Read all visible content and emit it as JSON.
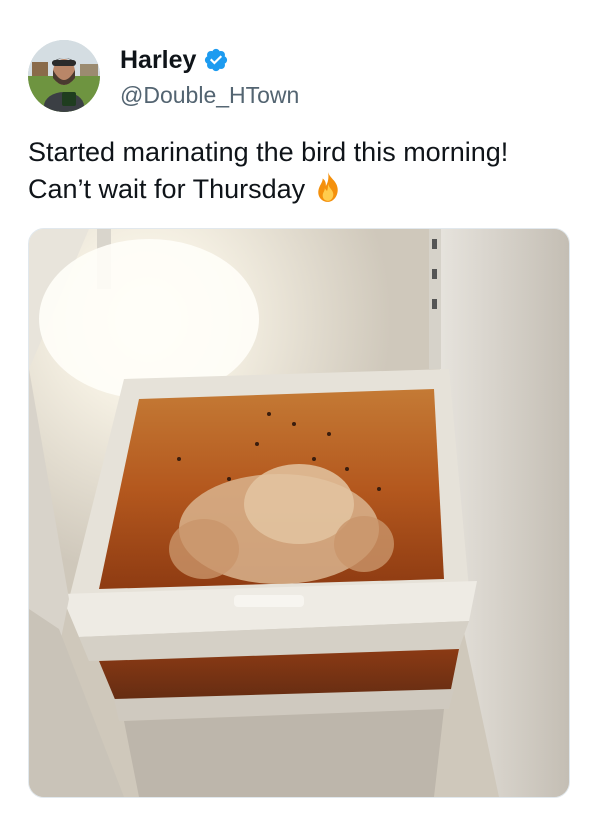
{
  "tweet": {
    "author": {
      "display_name": "Harley",
      "handle": "@Double_HTown",
      "verified": true,
      "avatar_icon": "profile-photo",
      "verified_icon": "verified-badge-icon"
    },
    "text": "Started marinating the bird this morning! Can’t wait for Thursday",
    "emoji_icon": "fire-icon",
    "media": {
      "description_icon": "photo-fridge-crisper-drawer"
    }
  },
  "colors": {
    "accent": "#1d9bf0",
    "handle": "#536471",
    "text": "#0f1419",
    "marinade": "#b4581e"
  }
}
